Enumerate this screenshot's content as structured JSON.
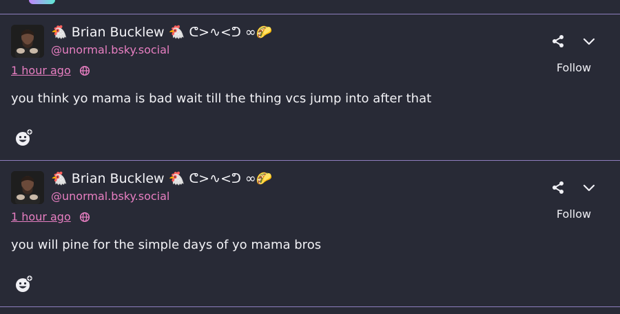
{
  "posts": [
    {
      "display_name": "🐔 Brian Bucklew 🐔 ᕦ>∿<ᕤ ∞🌮",
      "handle": "@unormal.bsky.social",
      "timestamp": "1 hour ago",
      "follow_label": "Follow",
      "text": "you think yo mama is bad wait till the thing vcs jump into after that"
    },
    {
      "display_name": "🐔 Brian Bucklew 🐔 ᕦ>∿<ᕤ ∞🌮",
      "handle": "@unormal.bsky.social",
      "timestamp": "1 hour ago",
      "follow_label": "Follow",
      "text": "you will pine for the simple days of yo mama bros"
    }
  ],
  "colors": {
    "background": "#282a36",
    "accent_pink": "#e87fc2",
    "divider": "#8f7fbf"
  },
  "icons": [
    "globe-icon",
    "share-icon",
    "chevron-down-icon",
    "add-reaction-icon"
  ]
}
